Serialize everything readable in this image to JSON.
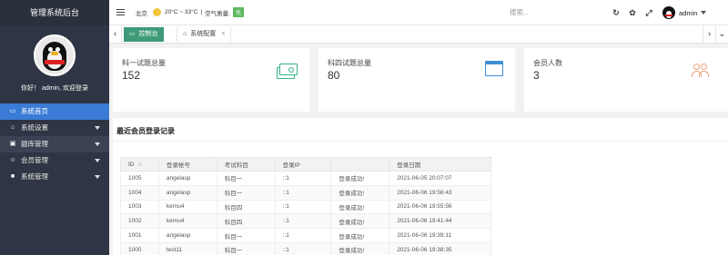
{
  "app": {
    "title": "管理系统后台"
  },
  "sidebar": {
    "welcome": "你好！ admin, 欢迎登录",
    "items": [
      {
        "label": "系统首页",
        "icon": "monitor-icon"
      },
      {
        "label": "系统设置",
        "icon": "home-icon"
      },
      {
        "label": "题库管理",
        "icon": "desktop-icon"
      },
      {
        "label": "会员管理",
        "icon": "users-icon"
      },
      {
        "label": "系统管理",
        "icon": "list-icon"
      }
    ]
  },
  "topbar": {
    "city": "北京",
    "temp": "20°C ~ 33°C",
    "air_label": "空气质量:",
    "air_value": "优",
    "search_placeholder": "搜索...",
    "user": "admin"
  },
  "tabs": [
    {
      "label": "控制台"
    },
    {
      "label": "系统配置"
    }
  ],
  "stats": [
    {
      "label": "科一试题总量",
      "value": "152",
      "icon": "money-icon"
    },
    {
      "label": "科四试题总量",
      "value": "80",
      "icon": "browser-icon"
    },
    {
      "label": "会员人数",
      "value": "3",
      "icon": "users-icon"
    }
  ],
  "records": {
    "title": "最近会员登录记录",
    "columns": [
      "ID",
      "登录帐号",
      "考试科目",
      "登录IP",
      "",
      "登录日期"
    ],
    "rows": [
      {
        "id": "1005",
        "account": "angelasp",
        "subject": "科目一",
        "ip": "::1",
        "status": "登录成功!",
        "date": "2021-06-05 20:07:07"
      },
      {
        "id": "1004",
        "account": "angelasp",
        "subject": "科目一",
        "ip": "::1",
        "status": "登录成功!",
        "date": "2021-06-06 19:56:43"
      },
      {
        "id": "1003",
        "account": "kemu4",
        "subject": "科目四",
        "ip": "::1",
        "status": "登录成功!",
        "date": "2021-06-06 19:55:56"
      },
      {
        "id": "1002",
        "account": "kemu4",
        "subject": "科目四",
        "ip": "::1",
        "status": "登录成功!",
        "date": "2021-06-06 19:41:44"
      },
      {
        "id": "1001",
        "account": "angelasp",
        "subject": "科目一",
        "ip": "::1",
        "status": "登录成功!",
        "date": "2021-06-06 19:39:11"
      },
      {
        "id": "1000",
        "account": "test11",
        "subject": "科目一",
        "ip": "::1",
        "status": "登录成功!",
        "date": "2021-06-06 19:38:35"
      }
    ]
  },
  "colors": {
    "sidebar_bg": "#2f3544",
    "active_menu": "#3a7bd5",
    "active_tab": "#3f9a78",
    "air_badge": "#5bb85c"
  }
}
